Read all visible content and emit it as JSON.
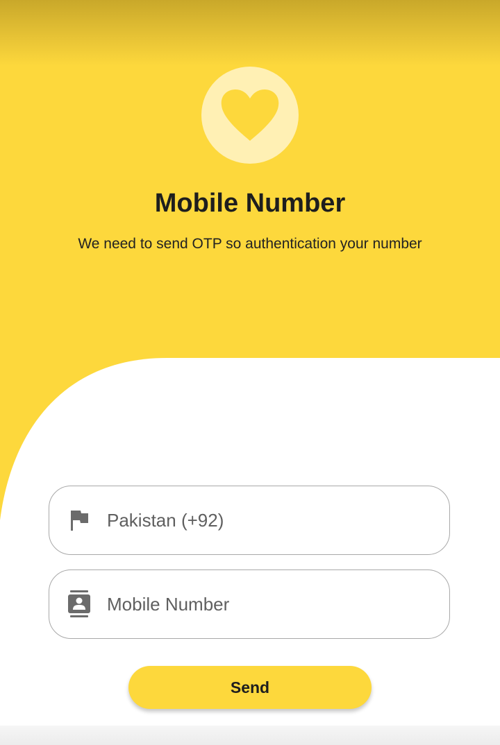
{
  "header": {
    "title": "Mobile Number",
    "subtitle": "We need to send OTP so authentication your number",
    "logo_icon": "heart-icon"
  },
  "form": {
    "country_field": {
      "icon": "flag-icon",
      "value": "Pakistan (+92)"
    },
    "mobile_field": {
      "icon": "contact-card-icon",
      "placeholder": "Mobile Number",
      "value": ""
    },
    "send_label": "Send"
  },
  "colors": {
    "accent": "#fdd83c",
    "heart_circle": "#fff0b4",
    "text_dark": "#1e1e1e",
    "field_border": "#a8a8a8",
    "placeholder": "#5f5f5f"
  }
}
